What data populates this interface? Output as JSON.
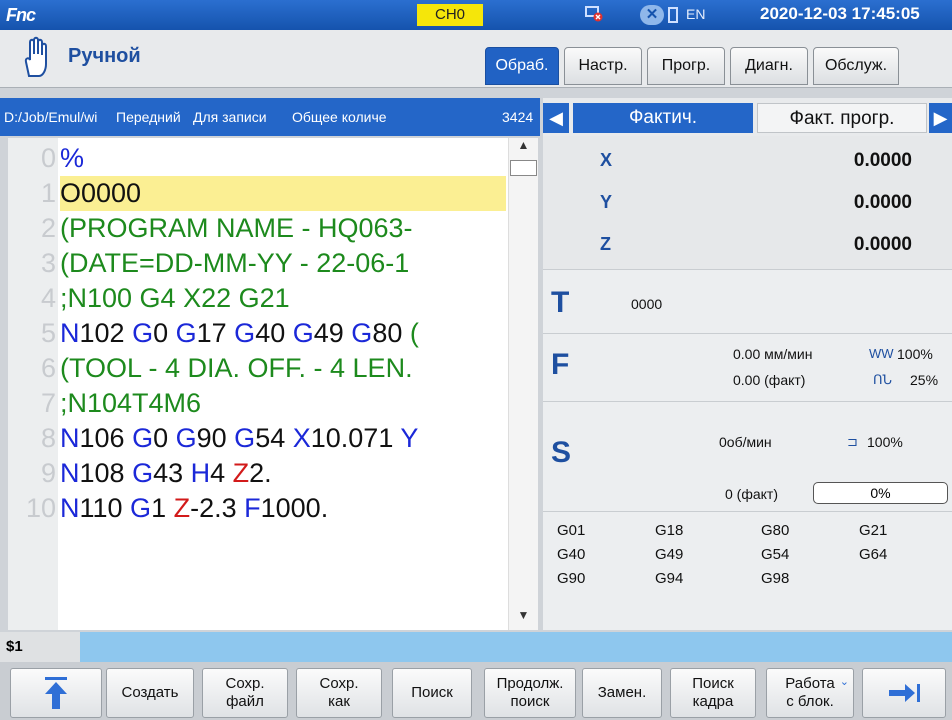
{
  "topbar": {
    "logo": "Fnc",
    "channel": "CH0",
    "lang": "EN",
    "datetime": "2020-12-03 17:45:05",
    "icons": [
      "network-error-icon",
      "close-icon",
      "keyboard-icon"
    ]
  },
  "mode": {
    "label": "Ручной",
    "tabs": [
      "Обраб.",
      "Настр.",
      "Прогр.",
      "Диагн.",
      "Обслуж."
    ],
    "active_tab": "Обраб."
  },
  "program": {
    "path": "D:/Job/Emul/wi",
    "header_fields": [
      "Передний",
      "Для записи",
      "Общее количе",
      "3424"
    ],
    "lines": [
      {
        "n": "0",
        "parts": [
          {
            "t": "%",
            "c": "kw"
          }
        ]
      },
      {
        "n": "1",
        "parts": [
          {
            "t": "O0000",
            "c": "blk"
          }
        ],
        "highlight": true
      },
      {
        "n": "2",
        "parts": [
          {
            "t": "(PROGRAM NAME - HQ063-",
            "c": "cmt"
          }
        ]
      },
      {
        "n": "3",
        "parts": [
          {
            "t": "(DATE=DD-MM-YY - 22-06-1",
            "c": "cmt"
          }
        ]
      },
      {
        "n": "4",
        "parts": [
          {
            "t": ";N100 G4 X22 G21",
            "c": "cmt"
          }
        ]
      },
      {
        "n": "5",
        "parts": [
          {
            "t": "N",
            "c": "kw"
          },
          {
            "t": "102 ",
            "c": "blk"
          },
          {
            "t": "G",
            "c": "kw"
          },
          {
            "t": "0 ",
            "c": "blk"
          },
          {
            "t": "G",
            "c": "kw"
          },
          {
            "t": "17 ",
            "c": "blk"
          },
          {
            "t": "G",
            "c": "kw"
          },
          {
            "t": "40 ",
            "c": "blk"
          },
          {
            "t": "G",
            "c": "kw"
          },
          {
            "t": "49 ",
            "c": "blk"
          },
          {
            "t": "G",
            "c": "kw"
          },
          {
            "t": "80 ",
            "c": "blk"
          },
          {
            "t": "(",
            "c": "cmt"
          }
        ]
      },
      {
        "n": "6",
        "parts": [
          {
            "t": "(TOOL - 4 DIA. OFF. - 4 LEN.",
            "c": "cmt"
          }
        ]
      },
      {
        "n": "7",
        "parts": [
          {
            "t": ";N104T4M6",
            "c": "cmt"
          }
        ]
      },
      {
        "n": "8",
        "parts": [
          {
            "t": "N",
            "c": "kw"
          },
          {
            "t": "106 ",
            "c": "blk"
          },
          {
            "t": "G",
            "c": "kw"
          },
          {
            "t": "0 ",
            "c": "blk"
          },
          {
            "t": "G",
            "c": "kw"
          },
          {
            "t": "90 ",
            "c": "blk"
          },
          {
            "t": "G",
            "c": "kw"
          },
          {
            "t": "54 ",
            "c": "blk"
          },
          {
            "t": "X",
            "c": "kw"
          },
          {
            "t": "10.071 ",
            "c": "blk"
          },
          {
            "t": "Y",
            "c": "kw"
          }
        ]
      },
      {
        "n": "9",
        "parts": [
          {
            "t": "N",
            "c": "kw"
          },
          {
            "t": "108 ",
            "c": "blk"
          },
          {
            "t": "G",
            "c": "kw"
          },
          {
            "t": "43 ",
            "c": "blk"
          },
          {
            "t": "H",
            "c": "kw"
          },
          {
            "t": "4 ",
            "c": "blk"
          },
          {
            "t": "Z",
            "c": "red"
          },
          {
            "t": "2.",
            "c": "blk"
          }
        ]
      },
      {
        "n": "10",
        "parts": [
          {
            "t": "N",
            "c": "kw"
          },
          {
            "t": "110 ",
            "c": "blk"
          },
          {
            "t": "G",
            "c": "kw"
          },
          {
            "t": "1 ",
            "c": "blk"
          },
          {
            "t": "Z",
            "c": "red"
          },
          {
            "t": "-2.3 ",
            "c": "blk"
          },
          {
            "t": "F",
            "c": "kw"
          },
          {
            "t": "1000.",
            "c": "blk"
          }
        ]
      }
    ]
  },
  "right": {
    "tabs": [
      "Фактич.",
      "Факт. прогр."
    ],
    "axes": [
      {
        "name": "X",
        "value": "0.0000"
      },
      {
        "name": "Y",
        "value": "0.0000"
      },
      {
        "name": "Z",
        "value": "0.0000"
      }
    ],
    "tool": {
      "label": "T",
      "value": "0000"
    },
    "feed": {
      "label": "F",
      "cmd": "0.00 мм/мин",
      "act": "0.00 (факт)",
      "override": "100%",
      "rapid": "25%"
    },
    "spindle": {
      "label": "S",
      "cmd": "0об/мин",
      "override": "100%",
      "act": "0 (факт)",
      "load": "0%"
    },
    "gcodes": [
      "G01",
      "G18",
      "G80",
      "G21",
      "G40",
      "G49",
      "G54",
      "G64",
      "G90",
      "G94",
      "G98"
    ]
  },
  "cmd": {
    "label": "$1"
  },
  "softkeys": [
    "",
    "Создать",
    "Сохр. файл",
    "Сохр. как",
    "Поиск",
    "Продолж. поиск",
    "Замен.",
    "Поиск кадра",
    "Работа с блок.",
    ""
  ]
}
